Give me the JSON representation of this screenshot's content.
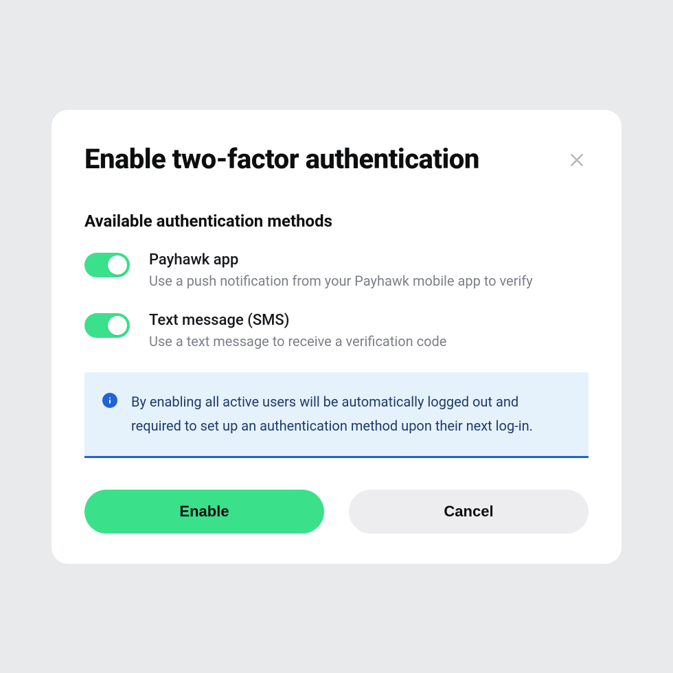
{
  "modal": {
    "title": "Enable two-factor authentication",
    "section_title": "Available authentication methods",
    "methods": [
      {
        "name": "Payhawk app",
        "description": "Use a push notification from your Payhawk mobile app to verify",
        "enabled": true
      },
      {
        "name": "Text message (SMS)",
        "description": "Use a text message to receive a verification code",
        "enabled": true
      }
    ],
    "info_text": "By enabling all active users will be automatically logged out and required to set up an authentication method upon their next log-in.",
    "primary_button": "Enable",
    "secondary_button": "Cancel"
  },
  "colors": {
    "accent_green": "#3be08b",
    "info_blue": "#1f63d6",
    "info_bg": "#e5f2fc"
  }
}
